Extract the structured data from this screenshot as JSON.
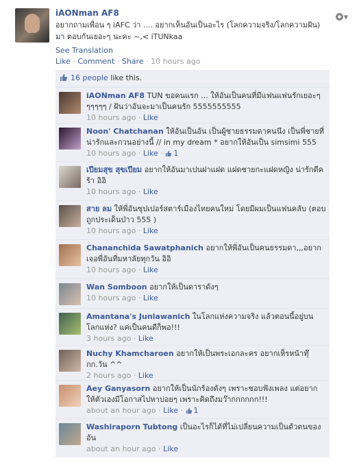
{
  "post": {
    "author": "iAONman AF8",
    "text": "อยากถามเพื่อน ๆ iAFC ว่า .... อยากเห็นอันเป็นอะไร (โลกความจริง/โลกความฝัน) มา ตอบกันเยอะๆ นะคะ ~,< iTUNkaa",
    "see_translation": "See Translation",
    "like_label": "Like",
    "comment_label": "Comment",
    "share_label": "Share",
    "time": "10 hours ago",
    "sep": "·"
  },
  "likes": {
    "count_text": "16 people",
    "suffix": " like this."
  },
  "comments": [
    {
      "name": "iAONman AF8",
      "text": "TUN ขอคนแรก ... ให้อันเป็นคนที่มีแฟนแฟนรักเยอะๆๆๆๆๆๆ / ฝันว่าอันจะมาเป็นคนรัก 5555555555",
      "time": "10 hours ago",
      "like": "Like",
      "likes": ""
    },
    {
      "name": "Noon' Chatchanan",
      "text": "ให้อันเป็นอัน เป็นผู้ชายธรรมดาคนนึง เป็นพี่ชายที่น่ารักและกวนอย่างนี้ // in my dream * อยากให้อันเป็น simsimi 555",
      "time": "10 hours ago",
      "like": "Like",
      "likes": "1"
    },
    {
      "name": "เปียมสุข สุขเปียม",
      "text": "อยากให้อันมาเปนฝาแฝด แฝดชายกะแฝดหญิง น่ารักดีคร้า อิอิ",
      "time": "10 hours ago",
      "like": "Like",
      "likes": ""
    },
    {
      "name": "สาย ลม",
      "text": "ให้พี่อันซุปเปอร์สตาร์เมืองไทยคนใหม่ โดยมีผมเป็นแฟนคลับ (ตอบถูกประเด็นป่าว 555 )",
      "time": "10 hours ago",
      "like": "Like",
      "likes": ""
    },
    {
      "name": "Chananchida Sawatphanich",
      "text": "อยากให้พี่อันเป็นคนธรรมดา,,,อยากเจอพี่อันที่มหาลัยทุกวัน อิอิ",
      "time": "10 hours ago",
      "like": "Like",
      "likes": ""
    },
    {
      "name": "Wan Somboon",
      "text": "อยากให้เป็นดาราดังๆ",
      "time": "10 hours ago",
      "like": "Like",
      "likes": ""
    },
    {
      "name": "Amantana's Junlawanich",
      "text": "ในโลกแห่งความจริง แล้วตอนนี้อยู่บนโลกแห่ง? แค่เป็นคนดีก็พอ!!!",
      "time": "3 hours ago",
      "like": "Like",
      "likes": ""
    },
    {
      "name": "Nuchy Khamcharoen",
      "text": "อยากให้เป็นพระเอกละคร อยากเห็รหน้าทุ๊กก.วัน ^^",
      "time": "2 hours ago",
      "like": "Like",
      "likes": ""
    },
    {
      "name": "Aey Ganyasorn",
      "text": "อยากให้เป็นนักร้องดังๆ เพราะชอบฟังเพลง แต่อยากให้ตัวเองมีโอกาสไปหาบ่อยๆ เพราะคิดถึงมว๊ากกกกกก!!!",
      "time": "about an hour ago",
      "like": "Like",
      "likes": "1"
    },
    {
      "name": "Washiraporn Tubtong",
      "text": "เป็นอะไรก็ได้ที่ไม่เปลี่ยนความเป็นตัวตนของอัน",
      "time": "about an hour ago",
      "like": "Like",
      "likes": ""
    }
  ],
  "colors": {
    "link": "#3b5998",
    "ufi_bg": "#edeff4",
    "meta": "#999999"
  },
  "icons": {
    "settings": "globe-gear-icon",
    "like": "thumbs-up-icon"
  }
}
